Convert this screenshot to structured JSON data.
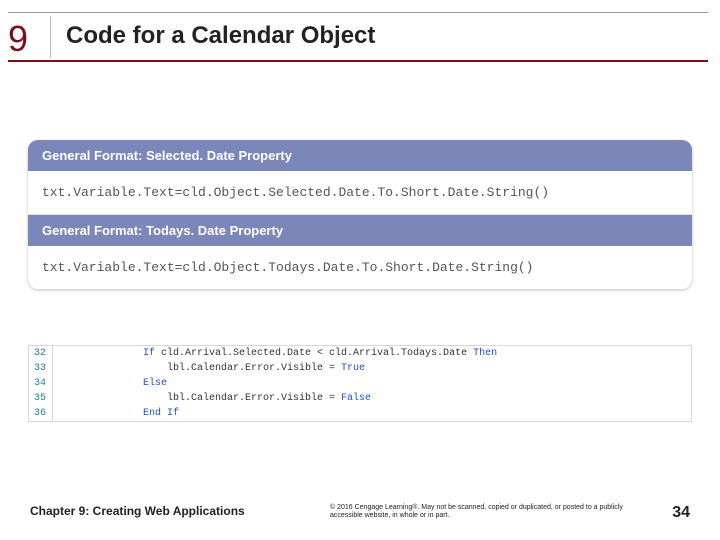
{
  "header": {
    "chapter_number": "9",
    "title": "Code for a Calendar Object"
  },
  "formats": [
    {
      "heading": "General Format: Selected. Date Property",
      "code": "txt.Variable.Text=cld.Object.Selected.Date.To.Short.Date.String()"
    },
    {
      "heading": "General Format: Todays. Date Property",
      "code": "txt.Variable.Text=cld.Object.Todays.Date.To.Short.Date.String()"
    }
  ],
  "code": {
    "lines": [
      {
        "num": "32",
        "indent": "",
        "pre_kw": "",
        "kw": "If ",
        "mid": "cld.Arrival.Selected.Date < cld.Arrival.Todays.Date ",
        "kw2": "Then",
        "post": ""
      },
      {
        "num": "33",
        "indent": "    ",
        "pre_kw": "",
        "kw": "",
        "mid": "lbl.Calendar.Error.Visible = ",
        "kw2": "True",
        "post": ""
      },
      {
        "num": "34",
        "indent": "",
        "pre_kw": "",
        "kw": "Else",
        "mid": "",
        "kw2": "",
        "post": ""
      },
      {
        "num": "35",
        "indent": "    ",
        "pre_kw": "",
        "kw": "",
        "mid": "lbl.Calendar.Error.Visible = ",
        "kw2": "False",
        "post": ""
      },
      {
        "num": "36",
        "indent": "",
        "pre_kw": "",
        "kw": "End If",
        "mid": "",
        "kw2": "",
        "post": ""
      }
    ]
  },
  "footer": {
    "chapter": "Chapter 9: Creating Web Applications",
    "copyright": "© 2016 Cengage Learning®. May not be scanned, copied or duplicated, or posted to a publicly accessible website, in whole or in part.",
    "page": "34"
  }
}
